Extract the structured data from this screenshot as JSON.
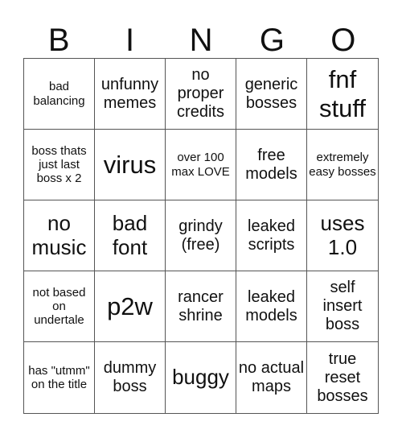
{
  "header": {
    "letters": [
      "B",
      "I",
      "N",
      "G",
      "O"
    ]
  },
  "card": {
    "cells": [
      {
        "text": "bad balancing",
        "size": "s-sm"
      },
      {
        "text": "unfunny memes",
        "size": "s-md"
      },
      {
        "text": "no proper credits",
        "size": "s-md"
      },
      {
        "text": "generic bosses",
        "size": "s-md"
      },
      {
        "text": "fnf stuff",
        "size": "s-xl"
      },
      {
        "text": "boss thats just last boss x 2",
        "size": "s-sm"
      },
      {
        "text": "virus",
        "size": "s-xl"
      },
      {
        "text": "over 100 max LOVE",
        "size": "s-sm"
      },
      {
        "text": "free models",
        "size": "s-md"
      },
      {
        "text": "extremely easy bosses",
        "size": "s-sm"
      },
      {
        "text": "no music",
        "size": "s-lg"
      },
      {
        "text": "bad font",
        "size": "s-lg"
      },
      {
        "text": "grindy (free)",
        "size": "s-md"
      },
      {
        "text": "leaked scripts",
        "size": "s-md"
      },
      {
        "text": "uses 1.0",
        "size": "s-lg"
      },
      {
        "text": "not based on undertale",
        "size": "s-sm"
      },
      {
        "text": "p2w",
        "size": "s-xl"
      },
      {
        "text": "rancer shrine",
        "size": "s-md"
      },
      {
        "text": "leaked models",
        "size": "s-md"
      },
      {
        "text": "self insert boss",
        "size": "s-md"
      },
      {
        "text": "has \"utmm\" on the title",
        "size": "s-sm"
      },
      {
        "text": "dummy boss",
        "size": "s-md"
      },
      {
        "text": "buggy",
        "size": "s-lg"
      },
      {
        "text": "no actual maps",
        "size": "s-md"
      },
      {
        "text": "true reset bosses",
        "size": "s-md"
      }
    ]
  }
}
